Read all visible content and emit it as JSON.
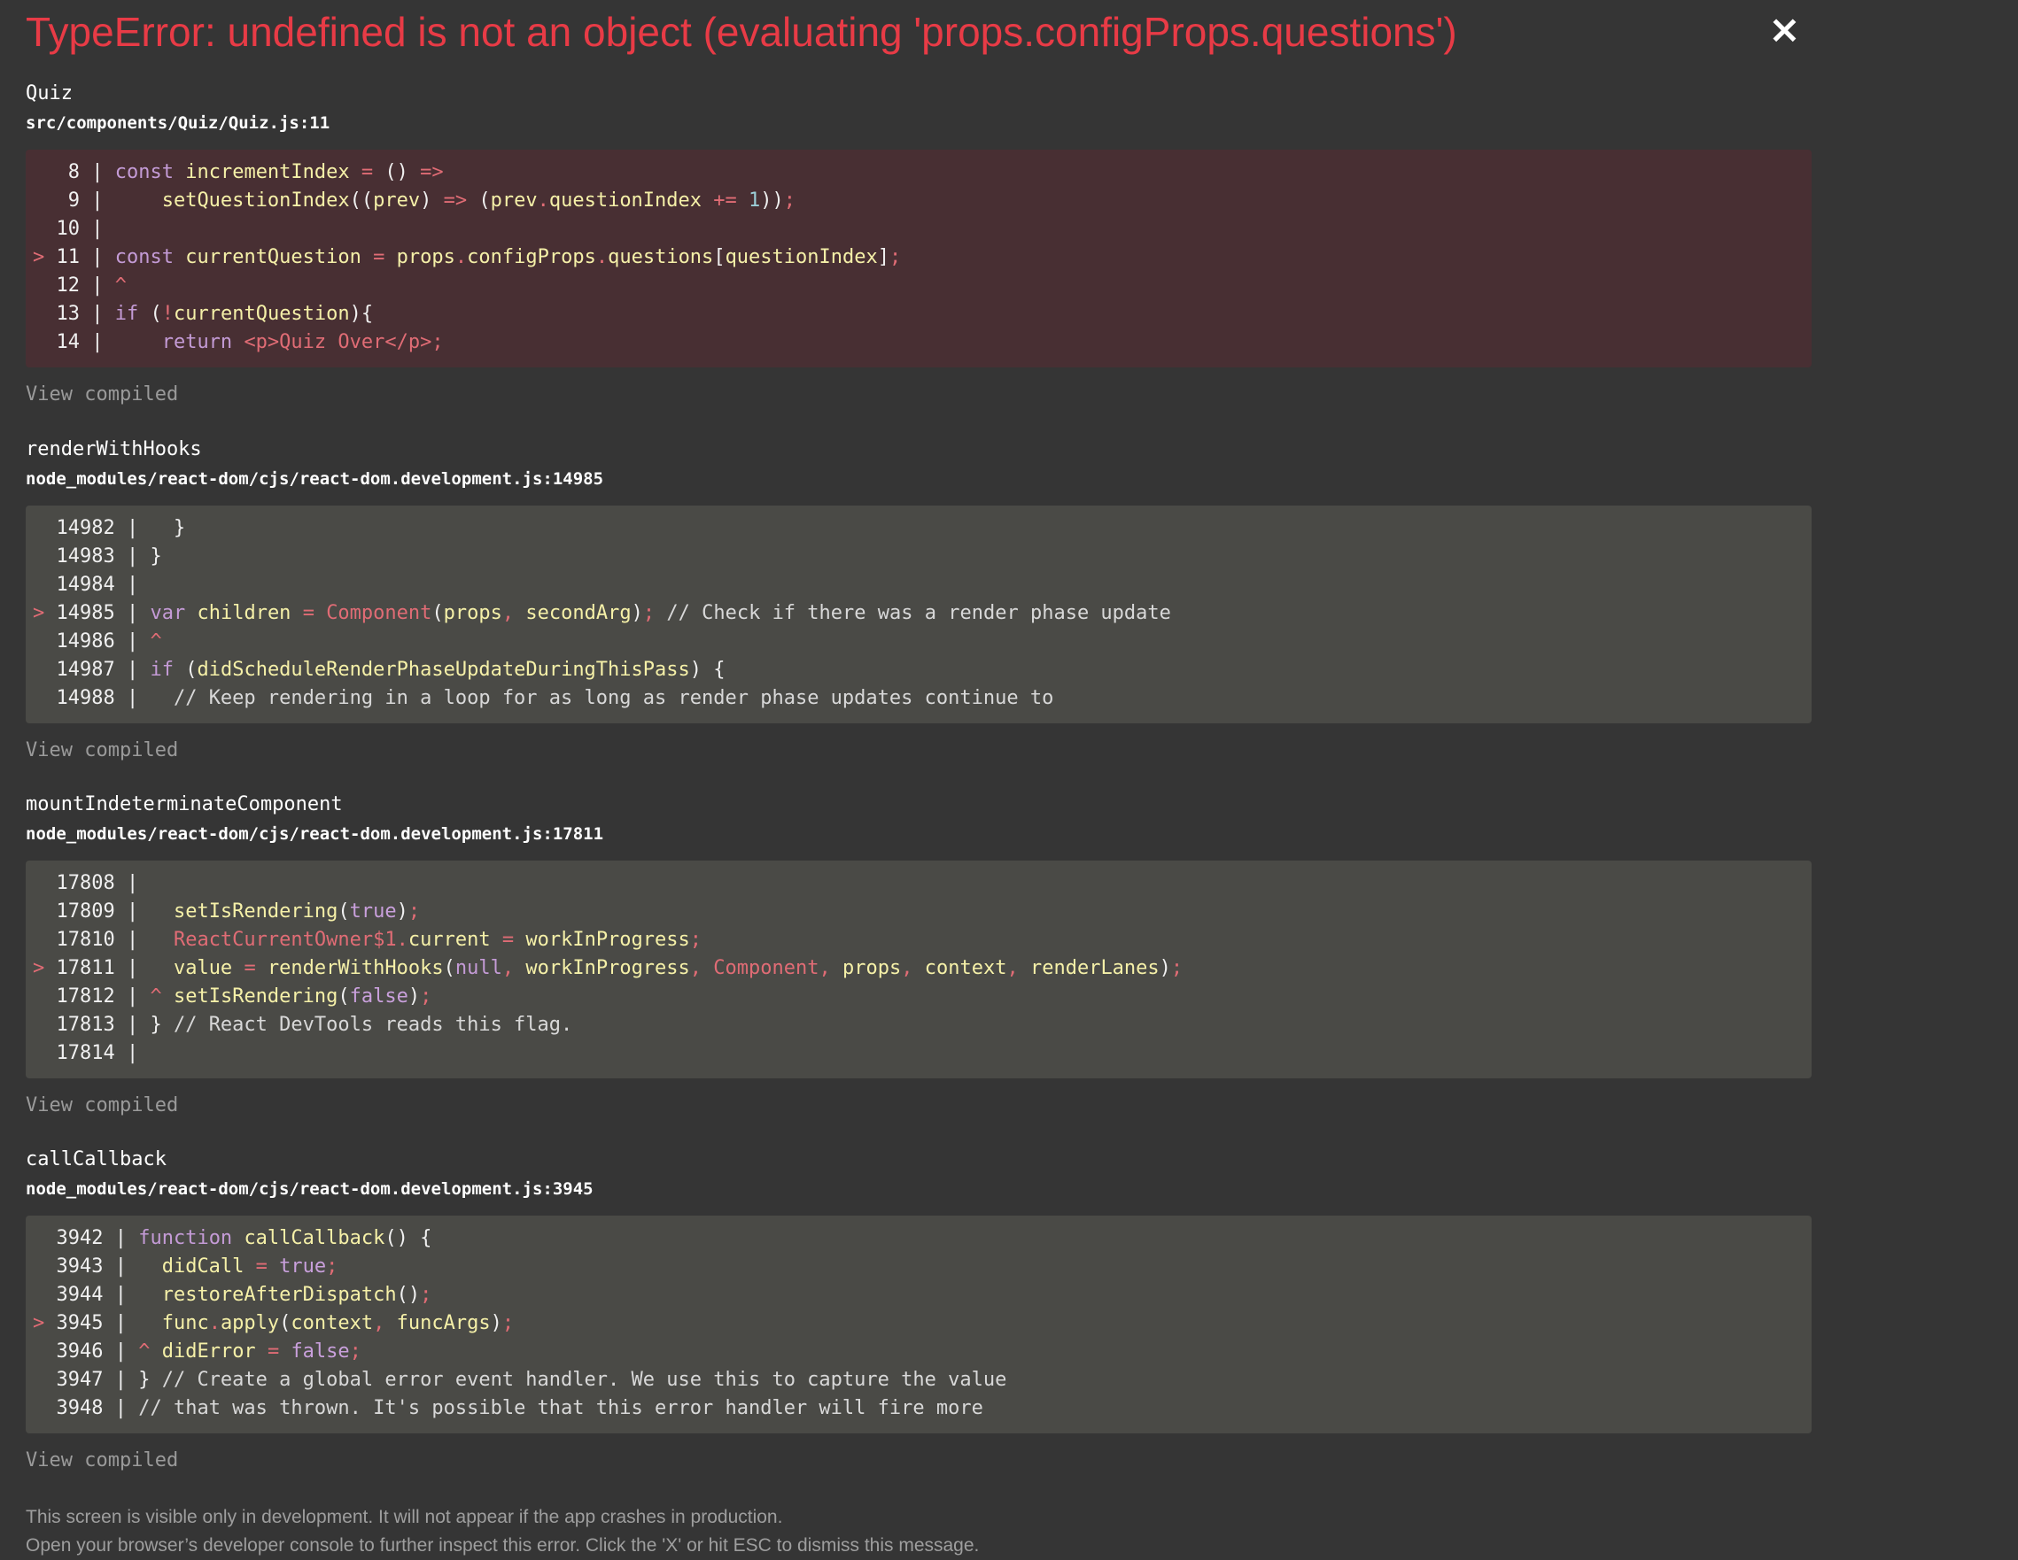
{
  "error": {
    "title": "TypeError: undefined is not an object (evaluating 'props.configProps.questions')",
    "close_label": "×"
  },
  "frames": [
    {
      "function": "Quiz",
      "path": "src/components/Quiz/Quiz.js:11",
      "view_label": "View compiled",
      "lines": [
        {
          "marker": " ",
          "num": "8",
          "code": "const incrementIndex = () =>"
        },
        {
          "marker": " ",
          "num": "9",
          "code": "    setQuestionIndex((prev) => (prev.questionIndex += 1));"
        },
        {
          "marker": " ",
          "num": "10",
          "code": ""
        },
        {
          "marker": ">",
          "num": "11",
          "code": "const currentQuestion = props.configProps.questions[questionIndex];"
        },
        {
          "marker": " ",
          "num": "12",
          "code": "^"
        },
        {
          "marker": " ",
          "num": "13",
          "code": "if (!currentQuestion){"
        },
        {
          "marker": " ",
          "num": "14",
          "code": "    return <p>Quiz Over</p>;"
        }
      ]
    },
    {
      "function": "renderWithHooks",
      "path": "node_modules/react-dom/cjs/react-dom.development.js:14985",
      "view_label": "View compiled",
      "lines": [
        {
          "marker": " ",
          "num": "14982",
          "code": "  }"
        },
        {
          "marker": " ",
          "num": "14983",
          "code": "}"
        },
        {
          "marker": " ",
          "num": "14984",
          "code": ""
        },
        {
          "marker": ">",
          "num": "14985",
          "code": "var children = Component(props, secondArg); // Check if there was a render phase update"
        },
        {
          "marker": " ",
          "num": "14986",
          "code": "^"
        },
        {
          "marker": " ",
          "num": "14987",
          "code": "if (didScheduleRenderPhaseUpdateDuringThisPass) {"
        },
        {
          "marker": " ",
          "num": "14988",
          "code": "  // Keep rendering in a loop for as long as render phase updates continue to"
        }
      ]
    },
    {
      "function": "mountIndeterminateComponent",
      "path": "node_modules/react-dom/cjs/react-dom.development.js:17811",
      "view_label": "View compiled",
      "lines": [
        {
          "marker": " ",
          "num": "17808",
          "code": ""
        },
        {
          "marker": " ",
          "num": "17809",
          "code": "  setIsRendering(true);"
        },
        {
          "marker": " ",
          "num": "17810",
          "code": "  ReactCurrentOwner$1.current = workInProgress;"
        },
        {
          "marker": ">",
          "num": "17811",
          "code": "  value = renderWithHooks(null, workInProgress, Component, props, context, renderLanes);"
        },
        {
          "marker": " ",
          "num": "17812",
          "code": "^ setIsRendering(false);"
        },
        {
          "marker": " ",
          "num": "17813",
          "code": "} // React DevTools reads this flag."
        },
        {
          "marker": " ",
          "num": "17814",
          "code": ""
        }
      ]
    },
    {
      "function": "callCallback",
      "path": "node_modules/react-dom/cjs/react-dom.development.js:3945",
      "view_label": "View compiled",
      "lines": [
        {
          "marker": " ",
          "num": "3942",
          "code": "function callCallback() {"
        },
        {
          "marker": " ",
          "num": "3943",
          "code": "  didCall = true;"
        },
        {
          "marker": " ",
          "num": "3944",
          "code": "  restoreAfterDispatch();"
        },
        {
          "marker": ">",
          "num": "3945",
          "code": "  func.apply(context, funcArgs);"
        },
        {
          "marker": " ",
          "num": "3946",
          "code": "^ didError = false;"
        },
        {
          "marker": " ",
          "num": "3947",
          "code": "} // Create a global error event handler. We use this to capture the value"
        },
        {
          "marker": " ",
          "num": "3948",
          "code": "// that was thrown. It's possible that this error handler will fire more"
        }
      ]
    }
  ],
  "footer": {
    "line1": "This screen is visible only in development. It will not appear if the app crashes in production.",
    "line2": "Open your browser’s developer console to further inspect this error.  Click the 'X' or hit ESC to dismiss this message."
  },
  "colors": {
    "background": "#353535",
    "error_red": "#e83b46",
    "error_code_bg": "#482f33",
    "code_bg": "#4a4a46"
  }
}
